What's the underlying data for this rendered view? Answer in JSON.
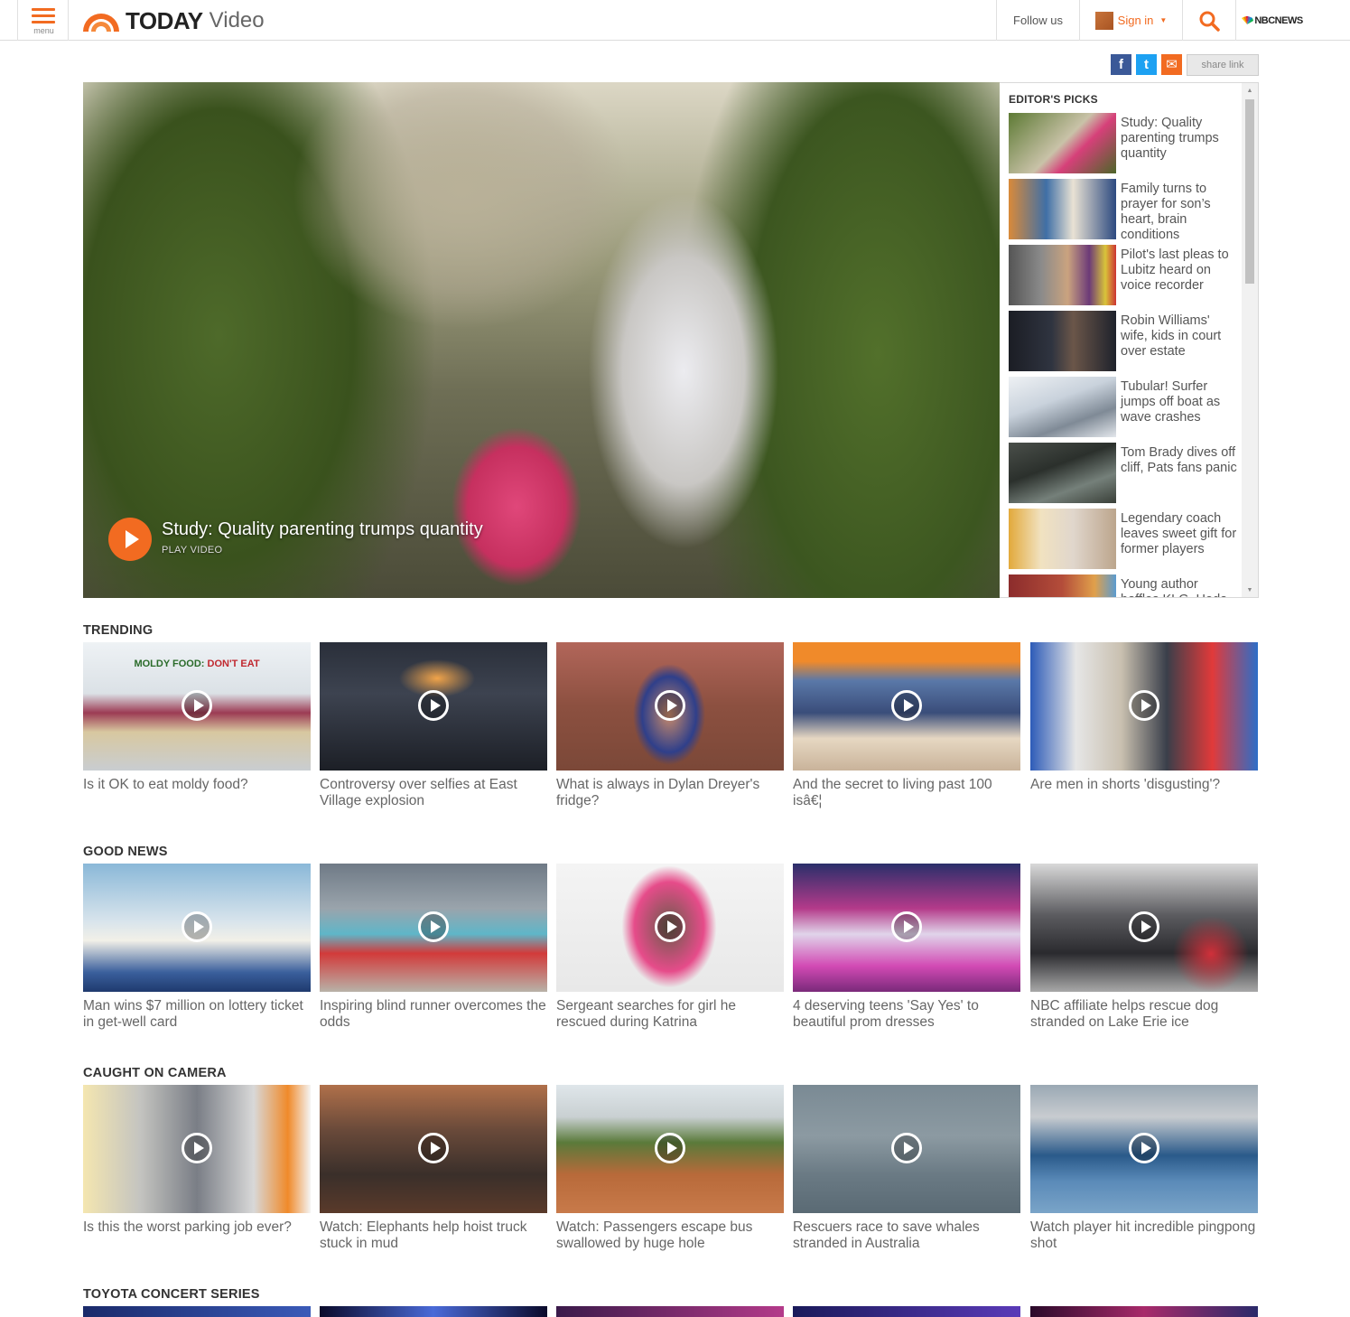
{
  "header": {
    "menu_label": "menu",
    "logo_today": "TODAY",
    "logo_section": "Video",
    "follow_label": "Follow us",
    "signin_label": "Sign in",
    "nbc_label": "NBCNEWS"
  },
  "share": {
    "facebook": "f",
    "twitter": "t",
    "email": "✉",
    "link_label": "share link"
  },
  "hero": {
    "title": "Study: Quality parenting trumps quantity",
    "subtitle": "PLAY VIDEO"
  },
  "editors_picks": {
    "heading": "EDITOR'S PICKS",
    "items": [
      {
        "title": "Study: Quality parenting trumps quantity"
      },
      {
        "title": "Family turns to prayer for son’s heart, brain conditions"
      },
      {
        "title": "Pilot's last pleas to Lubitz heard on voice recorder"
      },
      {
        "title": "Robin Williams' wife, kids in court over estate"
      },
      {
        "title": "Tubular! Surfer jumps off boat as wave crashes"
      },
      {
        "title": "Tom Brady dives off cliff, Pats fans panic"
      },
      {
        "title": "Legendary coach leaves sweet gift for former players"
      },
      {
        "title": "Young author baffles KLG, Hoda"
      }
    ]
  },
  "sections": {
    "trending": {
      "heading": "TRENDING",
      "thumb_text_a": "MOLDY FOOD: ",
      "thumb_text_b": "DON'T EAT",
      "items": [
        {
          "title": "Is it OK to eat moldy food?"
        },
        {
          "title": "Controversy over selfies at East Village explosion"
        },
        {
          "title": "What is always in Dylan Dreyer's fridge?"
        },
        {
          "title": "And the secret to living past 100 isâ€¦"
        },
        {
          "title": "Are men in shorts 'disgusting'?"
        }
      ]
    },
    "good_news": {
      "heading": "GOOD NEWS",
      "items": [
        {
          "title": "Man wins $7 million on lottery ticket in get-well card"
        },
        {
          "title": "Inspiring blind runner overcomes the odds"
        },
        {
          "title": "Sergeant searches for girl he rescued during Katrina"
        },
        {
          "title": "4 deserving teens 'Say Yes' to beautiful prom dresses"
        },
        {
          "title": "NBC affiliate helps rescue dog stranded on Lake Erie ice"
        }
      ]
    },
    "caught_on_camera": {
      "heading": "CAUGHT ON CAMERA",
      "items": [
        {
          "title": "Is this the worst parking job ever?"
        },
        {
          "title": "Watch: Elephants help hoist truck stuck in mud"
        },
        {
          "title": "Watch: Passengers escape bus swallowed by huge hole"
        },
        {
          "title": "Rescuers race to save whales stranded in Australia"
        },
        {
          "title": "Watch player hit incredible pingpong shot"
        }
      ]
    },
    "toyota": {
      "heading": "TOYOTA CONCERT SERIES"
    }
  },
  "colors": {
    "accent": "#f26b21",
    "text": "#555555",
    "heading": "#333333"
  }
}
